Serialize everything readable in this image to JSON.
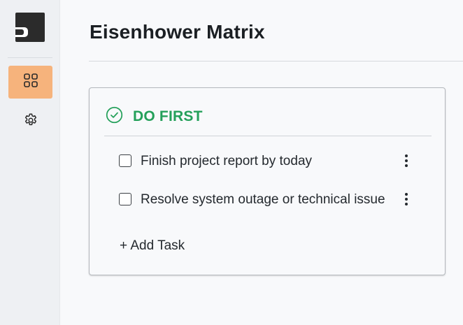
{
  "sidebar": {
    "items": [
      {
        "icon": "dashboard-grid-icon",
        "active": true
      },
      {
        "icon": "gear-icon",
        "active": false
      }
    ],
    "accent_color": "#f6b37c"
  },
  "header": {
    "title": "Eisenhower Matrix"
  },
  "quadrant": {
    "title": "DO FIRST",
    "title_color": "#24a05a",
    "icon": "check-circle-icon",
    "tasks": [
      {
        "text": "Finish project report by today",
        "checked": false
      },
      {
        "text": "Resolve system outage or technical issue",
        "checked": false
      }
    ],
    "add_label": "+ Add Task"
  }
}
